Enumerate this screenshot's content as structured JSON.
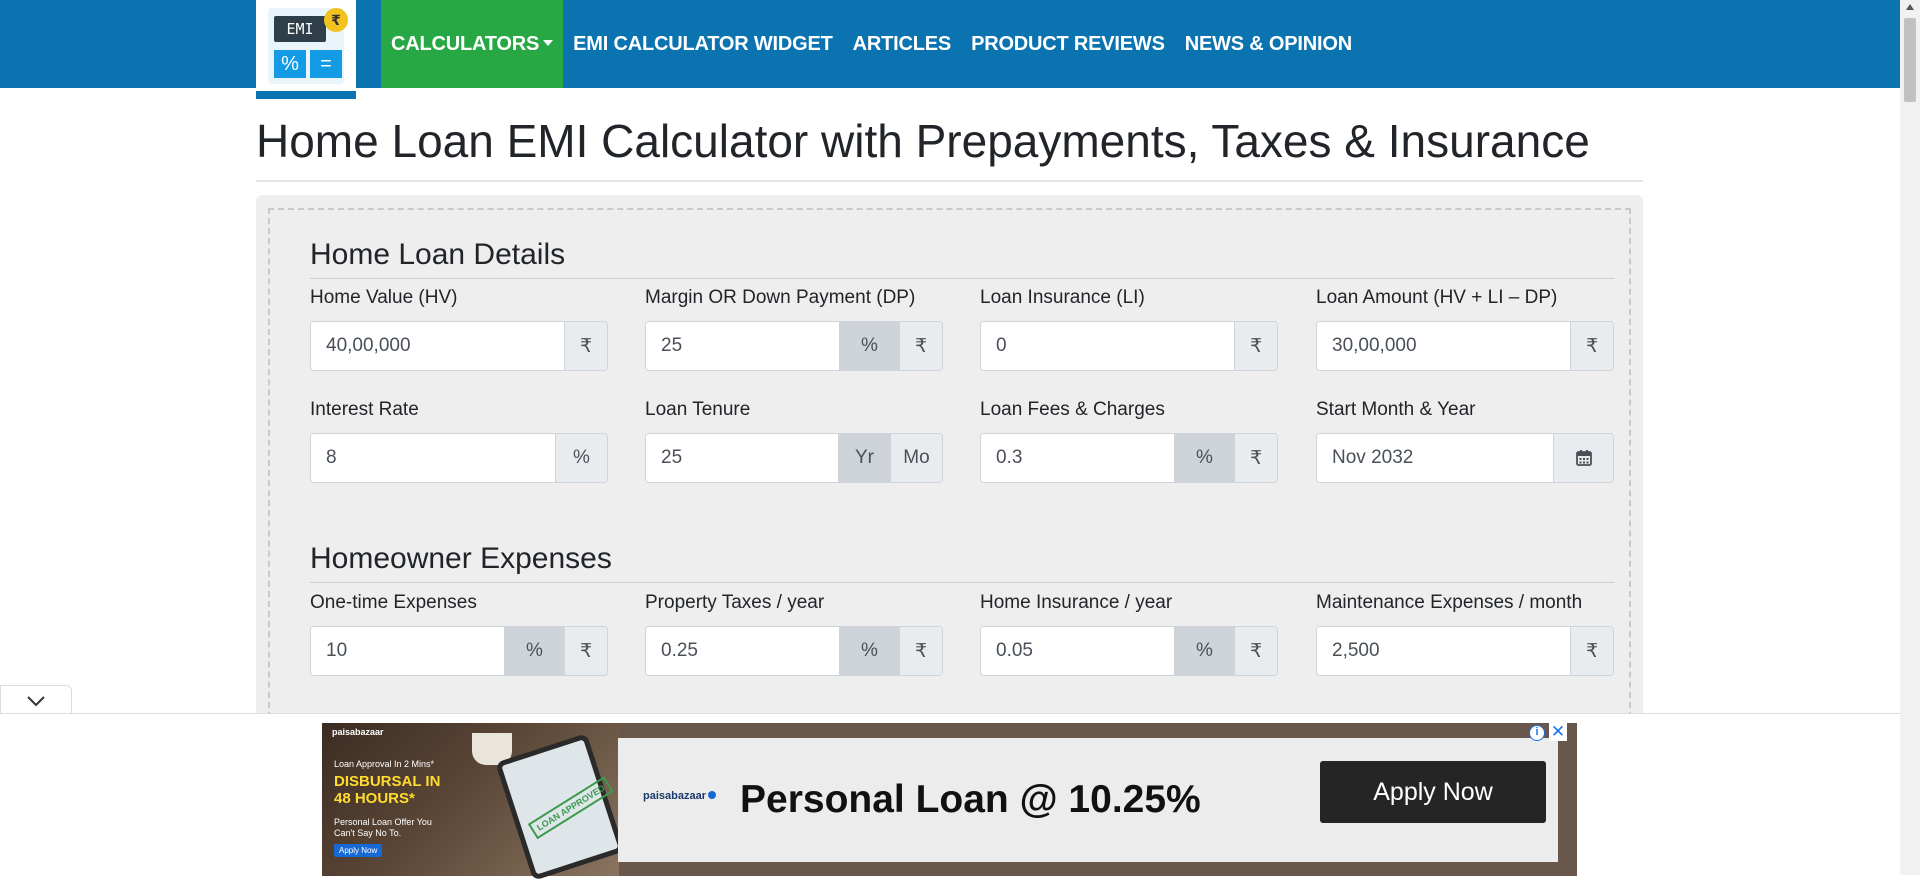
{
  "logo": {
    "screen_text": "EMI",
    "coin_glyph": "₹",
    "key_left": "%",
    "key_right": "="
  },
  "nav": {
    "items": [
      {
        "label": "CALCULATORS",
        "active": true
      },
      {
        "label": "EMI CALCULATOR WIDGET"
      },
      {
        "label": "ARTICLES"
      },
      {
        "label": "PRODUCT REVIEWS"
      },
      {
        "label": "NEWS & OPINION"
      }
    ]
  },
  "page_title": "Home Loan EMI Calculator with Prepayments, Taxes & Insurance",
  "loan_details": {
    "title": "Home Loan Details",
    "home_value": {
      "label": "Home Value (HV)",
      "value": "40,00,000",
      "addon": "₹"
    },
    "down_payment": {
      "label": "Margin OR Down Payment (DP)",
      "value": "25",
      "addon_pct": "%",
      "addon_cur": "₹",
      "selected": "%"
    },
    "loan_insurance": {
      "label": "Loan Insurance (LI)",
      "value": "0",
      "addon": "₹"
    },
    "loan_amount": {
      "label": "Loan Amount (HV + LI – DP)",
      "value": "30,00,000",
      "addon": "₹"
    },
    "interest_rate": {
      "label": "Interest Rate",
      "value": "8",
      "addon": "%"
    },
    "loan_tenure": {
      "label": "Loan Tenure",
      "value": "25",
      "addon_yr": "Yr",
      "addon_mo": "Mo",
      "selected": "Yr"
    },
    "loan_fees": {
      "label": "Loan Fees & Charges",
      "value": "0.3",
      "addon_pct": "%",
      "addon_cur": "₹",
      "selected": "%"
    },
    "start_month": {
      "label": "Start Month & Year",
      "value": "Nov 2032",
      "icon": "calendar-icon"
    }
  },
  "homeowner_expenses": {
    "title": "Homeowner Expenses",
    "one_time": {
      "label": "One-time Expenses",
      "value": "10",
      "addon_pct": "%",
      "addon_cur": "₹",
      "selected": "%"
    },
    "property_taxes": {
      "label": "Property Taxes / year",
      "value": "0.25",
      "addon_pct": "%",
      "addon_cur": "₹",
      "selected": "%"
    },
    "home_insurance": {
      "label": "Home Insurance / year",
      "value": "0.05",
      "addon_pct": "%",
      "addon_cur": "₹",
      "selected": "%"
    },
    "maintenance": {
      "label": "Maintenance Expenses / month",
      "value": "2,500",
      "addon": "₹"
    }
  },
  "ad": {
    "brand_small": "paisabazaar",
    "small_text": "Loan Approval In 2 Mins*",
    "headline": "DISBURSAL IN 48 HOURS*",
    "subtext": "Personal Loan Offer You Can't Say No To.",
    "apply_small": "Apply Now",
    "stamp": "LOAN APPROVED",
    "logo": "paisabazaar",
    "main_text": "Personal Loan @ 10.25%",
    "cta": "Apply Now",
    "info_glyph": "i",
    "close_glyph": "✕"
  },
  "colors": {
    "nav_bg": "#0a73b0",
    "nav_active": "#27a844",
    "panel_bg": "#eeeeee"
  }
}
